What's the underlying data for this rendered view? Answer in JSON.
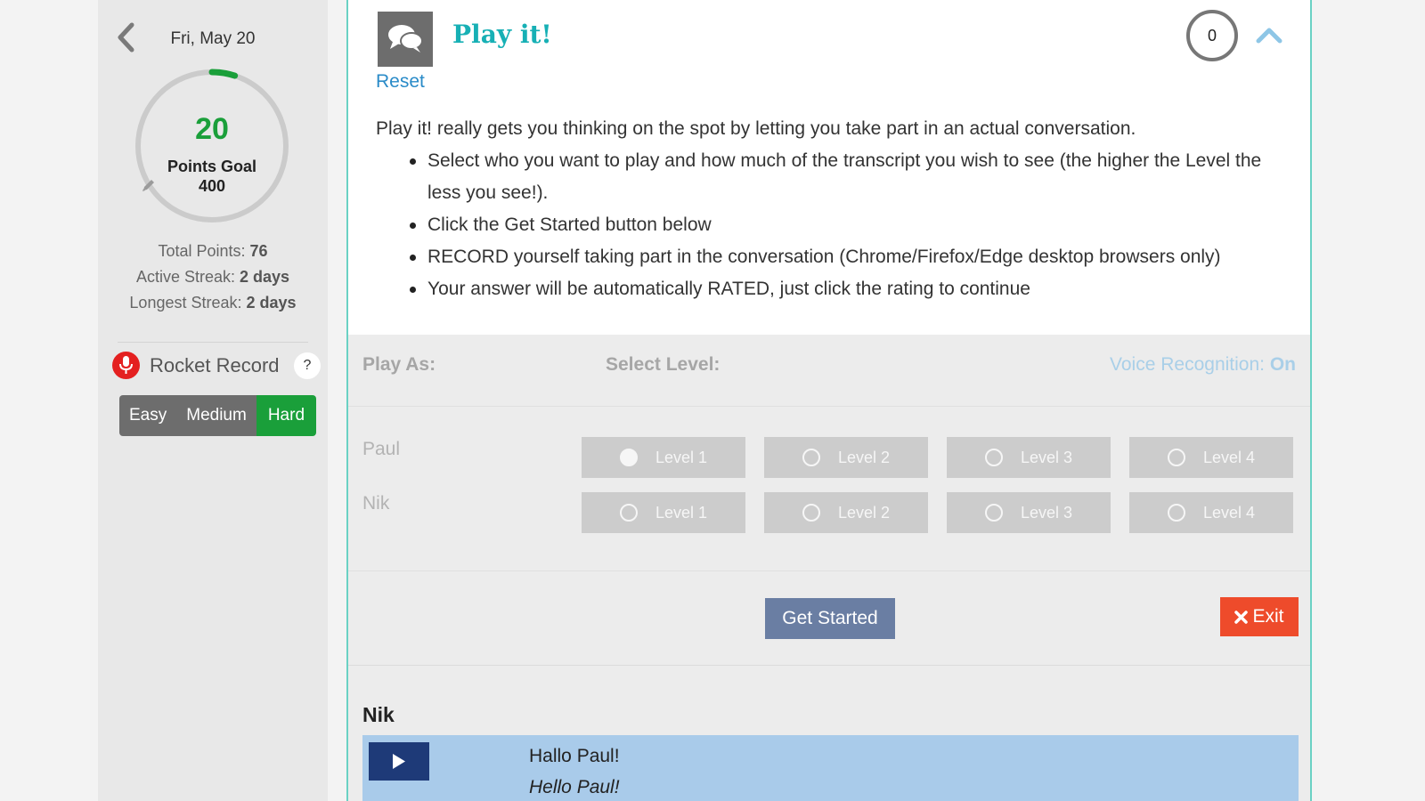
{
  "sidebar": {
    "date": "Fri, May 20",
    "points": "20",
    "points_goal_label": "Points Goal",
    "points_goal_value": "400",
    "goal_progress": 0.05,
    "stats": {
      "total_label": "Total Points: ",
      "total_value": "76",
      "active_label": "Active Streak: ",
      "active_value": "2 days",
      "longest_label": "Longest Streak: ",
      "longest_value": "2 days"
    },
    "rocket_record_label": "Rocket Record",
    "help_label": "?",
    "difficulty": {
      "options": [
        "Easy",
        "Medium",
        "Hard"
      ],
      "selected": "Hard"
    }
  },
  "panel": {
    "title": "Play it!",
    "reset": "Reset",
    "score": "0",
    "intro": "Play it! really gets you thinking on the spot by letting you take part in an actual conversation.",
    "bullets": [
      "Select who you want to play and how much of the transcript you wish to see (the higher the Level the less you see!).",
      "Click the Get Started button below",
      "RECORD yourself taking part in the conversation (Chrome/Firefox/Edge desktop browsers only)",
      "Your answer will be automatically RATED, just click the rating to continue"
    ],
    "settings": {
      "play_as_label": "Play As:",
      "select_level_label": "Select Level:",
      "voice_label": "Voice Recognition: ",
      "voice_value": "On",
      "characters": [
        {
          "name": "Paul",
          "levels": [
            "Level 1",
            "Level 2",
            "Level 3",
            "Level 4"
          ],
          "selected": 0
        },
        {
          "name": "Nik",
          "levels": [
            "Level 1",
            "Level 2",
            "Level 3",
            "Level 4"
          ],
          "selected": -1
        }
      ],
      "start_button": "Get Started",
      "exit_button": "Exit"
    },
    "transcript": {
      "speaker": "Nik",
      "line_original": "Hallo Paul!",
      "line_translation": "Hello Paul!"
    }
  },
  "colors": {
    "accent_green": "#1a9f3a",
    "title_teal": "#17b0b5",
    "link_blue": "#2a8bc8",
    "exit_red": "#ee4b2b",
    "start_blue": "#6a7ea3",
    "transcript_blue": "#a9cbea"
  }
}
